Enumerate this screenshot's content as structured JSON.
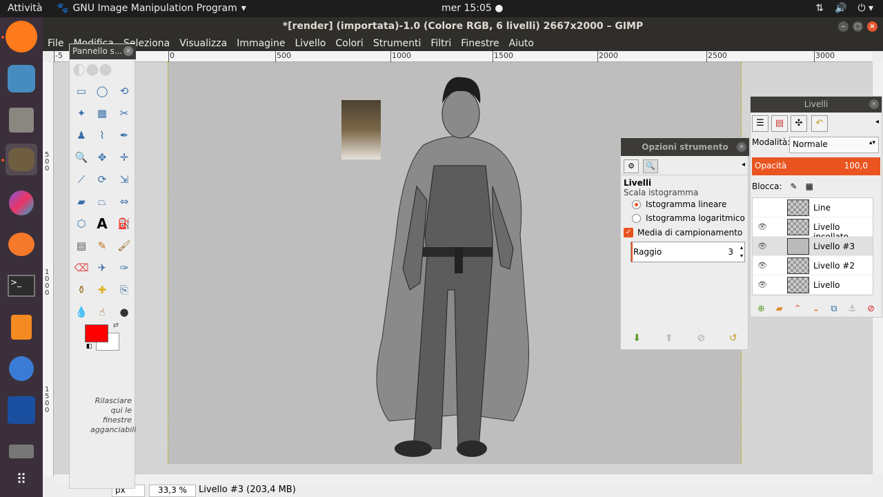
{
  "topbar": {
    "activities": "Attività",
    "app_name": "GNU Image Manipulation Program",
    "clock": "mer 15:05"
  },
  "dock": {
    "apps": [
      "firefox",
      "godot",
      "files",
      "gimp",
      "krita",
      "blender",
      "terminal",
      "sublime-text",
      "thunderbird",
      "graphics-app",
      "drive",
      "app-grid"
    ]
  },
  "window": {
    "title": "*[render] (importata)-1.0 (Colore RGB, 6 livelli) 2667x2000 – GIMP",
    "menu": [
      "File",
      "Modifica",
      "Seleziona",
      "Visualizza",
      "Immagine",
      "Livello",
      "Colori",
      "Strumenti",
      "Filtri",
      "Finestre",
      "Aiuto"
    ]
  },
  "ruler": {
    "h_labels": [
      "-5",
      "0",
      "500",
      "1000",
      "1500",
      "2000",
      "2500",
      "3000"
    ],
    "v_labels": [
      "500",
      "1000",
      "1500"
    ]
  },
  "toolbox": {
    "title": "Pannello s...",
    "dropzone": "Rilasciare qui le finestre agganciabili"
  },
  "tool_options": {
    "title": "Opzioni strumento",
    "section": "Livelli",
    "histogram_label": "Scala istogramma",
    "linear": "Istogramma lineare",
    "log": "Istogramma logaritmico",
    "sample_average": "Media di campionamento",
    "radius_label": "Raggio",
    "radius_value": "3"
  },
  "layers": {
    "title": "Livelli",
    "mode_label": "Modalità:",
    "mode_value": "Normale",
    "opacity_label": "Opacità",
    "opacity_value": "100,0",
    "lock_label": "Blocca:",
    "items": [
      {
        "name": "Line",
        "visible": false
      },
      {
        "name": "Livello incollato",
        "visible": true
      },
      {
        "name": "Livello #3",
        "visible": true
      },
      {
        "name": "Livello #2",
        "visible": true
      },
      {
        "name": "Livello",
        "visible": true
      }
    ]
  },
  "status": {
    "unit": "px",
    "zoom": "33,3 %",
    "info": "Livello #3 (203,4 MB)"
  },
  "colors": {
    "foreground": "#ff0000",
    "background": "#ffffff",
    "accent": "#e95420"
  }
}
